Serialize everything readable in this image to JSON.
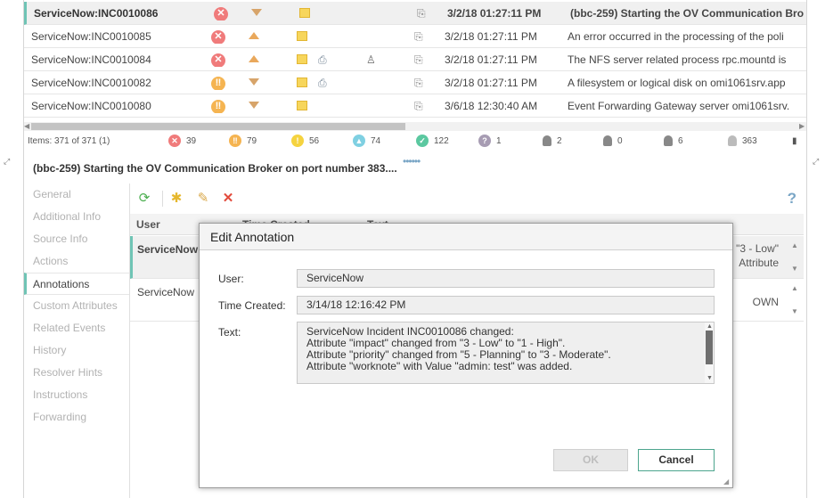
{
  "events": [
    {
      "name": "ServiceNow:INC0010086",
      "severity": "critical",
      "priority": "down",
      "has_note": true,
      "time": "3/2/18 01:27:11 PM",
      "description": "(bbc-259) Starting the OV Communication Bro",
      "selected": true
    },
    {
      "name": "ServiceNow:INC0010085",
      "severity": "critical",
      "priority": "up",
      "has_note": true,
      "time": "3/2/18 01:27:11 PM",
      "description": "An error occurred in the processing of the poli"
    },
    {
      "name": "ServiceNow:INC0010084",
      "severity": "critical",
      "priority": "up",
      "has_note": true,
      "time": "3/2/18 01:27:11 PM",
      "description": "The NFS server related process rpc.mountd is"
    },
    {
      "name": "ServiceNow:INC0010082",
      "severity": "major",
      "priority": "down",
      "has_note": true,
      "time": "3/2/18 01:27:11 PM",
      "description": "A filesystem or logical disk on omi1061srv.app"
    },
    {
      "name": "ServiceNow:INC0010080",
      "severity": "major",
      "priority": "down",
      "has_note": true,
      "time": "3/6/18 12:30:40 AM",
      "description": "Event Forwarding Gateway server omi1061srv."
    }
  ],
  "status_bar": {
    "items_label": "Items:  371 of 371  (1)",
    "critical": "39",
    "major": "79",
    "minor": "56",
    "warning": "74",
    "normal": "122",
    "unknown": "1",
    "user1": "2",
    "user2": "0",
    "user3": "6",
    "user4": "363"
  },
  "detail": {
    "title": "(bbc-259) Starting the OV Communication Broker on port number 383...."
  },
  "nav": {
    "items": [
      "General",
      "Additional Info",
      "Source Info",
      "Actions",
      "Annotations",
      "Custom Attributes",
      "Related Events",
      "History",
      "Resolver Hints",
      "Instructions",
      "Forwarding"
    ],
    "active_index": 4
  },
  "annotations_grid": {
    "col_user": "User",
    "col_time": "Time Created",
    "col_text": "Text",
    "rows": [
      {
        "user": "ServiceNow",
        "text_tail_1": "\"3 - Low\"",
        "text_tail_2": "Attribute"
      },
      {
        "user": "ServiceNow",
        "text_tail_1": "OWN",
        "text_tail_2": ""
      }
    ]
  },
  "dialog": {
    "title": "Edit Annotation",
    "user_label": "User:",
    "user_value": "ServiceNow",
    "time_label": "Time Created:",
    "time_value": "3/14/18 12:16:42 PM",
    "text_label": "Text:",
    "text_lines": [
      "ServiceNow Incident INC0010086 changed:",
      "Attribute \"impact\" changed from \"3 - Low\" to \"1 - High\".",
      "Attribute \"priority\" changed from \"5 - Planning\" to \"3 - Moderate\".",
      "Attribute \"worknote\" with Value \"admin: test\" was added."
    ],
    "ok_label": "OK",
    "cancel_label": "Cancel"
  },
  "colors": {
    "accent": "#6fc4b5",
    "critical": "#f07b7b",
    "major": "#f5b451",
    "cancel_border": "#4ca58d"
  }
}
